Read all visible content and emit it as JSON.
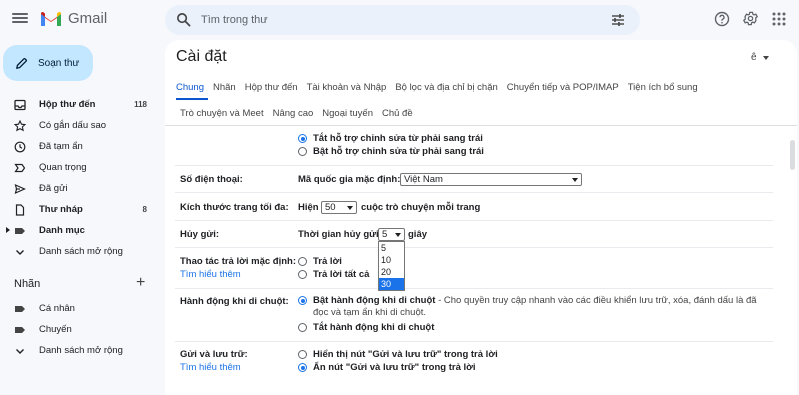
{
  "app": {
    "name": "Gmail"
  },
  "search": {
    "placeholder": "Tìm trong thư"
  },
  "compose": {
    "label": "Soạn thư"
  },
  "nav": [
    {
      "label": "Hộp thư đến",
      "count": "118",
      "bold": true,
      "icon": "inbox-icon"
    },
    {
      "label": "Có gắn dấu sao",
      "count": "",
      "bold": false,
      "icon": "star-icon"
    },
    {
      "label": "Đã tạm ẩn",
      "count": "",
      "bold": false,
      "icon": "clock-icon"
    },
    {
      "label": "Quan trọng",
      "count": "",
      "bold": false,
      "icon": "important-icon"
    },
    {
      "label": "Đã gửi",
      "count": "",
      "bold": false,
      "icon": "send-icon"
    },
    {
      "label": "Thư nháp",
      "count": "8",
      "bold": true,
      "icon": "draft-icon"
    },
    {
      "label": "Danh mục",
      "count": "",
      "bold": true,
      "icon": "label-icon"
    },
    {
      "label": "Danh sách mở rộng",
      "count": "",
      "bold": false,
      "icon": "chevron-down-icon"
    }
  ],
  "labels": {
    "heading": "Nhãn",
    "add": "+",
    "items": [
      {
        "label": "Cá nhân",
        "icon": "label-icon"
      },
      {
        "label": "Chuyến",
        "icon": "label-icon"
      },
      {
        "label": "Danh sách mở rộng",
        "icon": "chevron-down-icon"
      }
    ]
  },
  "settings": {
    "title": "Cài đặt",
    "lang": "ê",
    "tabs_row1": [
      "Chung",
      "Nhãn",
      "Hộp thư đến",
      "Tài khoản và Nhập",
      "Bộ lọc và địa chỉ bị chặn",
      "Chuyển tiếp và POP/IMAP",
      "Tiện ích bổ sung"
    ],
    "tabs_row2": [
      "Trò chuyện và Meet",
      "Nâng cao",
      "Ngoại tuyến",
      "Chủ đề"
    ],
    "rtl": {
      "on": "Tắt hỗ trợ chỉnh sửa từ phải sang trái",
      "off": "Bật hỗ trợ chỉnh sửa từ phải sang trái"
    },
    "phone": {
      "label": "Số điện thoại:",
      "text": "Mã quốc gia mặc định:",
      "value": "Việt Nam"
    },
    "page_size": {
      "label": "Kích thước trang tối đa:",
      "prefix": "Hiện",
      "value": "50",
      "suffix": "cuộc trò chuyện mỗi trang"
    },
    "undo": {
      "label": "Hủy gửi:",
      "text": "Thời gian hủy gửi:",
      "value": "5",
      "suffix": "giây",
      "options": [
        "5",
        "10",
        "20",
        "30"
      ],
      "highlighted": "30"
    },
    "reply": {
      "label": "Thao tác trả lời mặc định:",
      "link": "Tìm hiểu thêm",
      "opt1": "Trả lời",
      "opt2": "Trả lời tất cả"
    },
    "hover": {
      "label": "Hành động khi di chuột:",
      "on_title": "Bật hành động khi di chuột",
      "on_desc": " - Cho quyền truy cập nhanh vào các điều khiển lưu trữ, xóa, đánh dấu là đã đọc và tạm ẩn khi di chuột.",
      "off": "Tắt hành động khi di chuột"
    },
    "send_archive": {
      "label": "Gửi và lưu trữ:",
      "link": "Tìm hiểu thêm",
      "show": "Hiển thị nút \"Gửi và lưu trữ\" trong trả lời",
      "hide": "Ẩn nút \"Gửi và lưu trữ\" trong trả lời"
    }
  },
  "colors": {
    "accent": "#0b57d0",
    "compose_bg": "#c2e7ff",
    "app_bg": "#f6f8fc",
    "link": "#1a73e8"
  }
}
